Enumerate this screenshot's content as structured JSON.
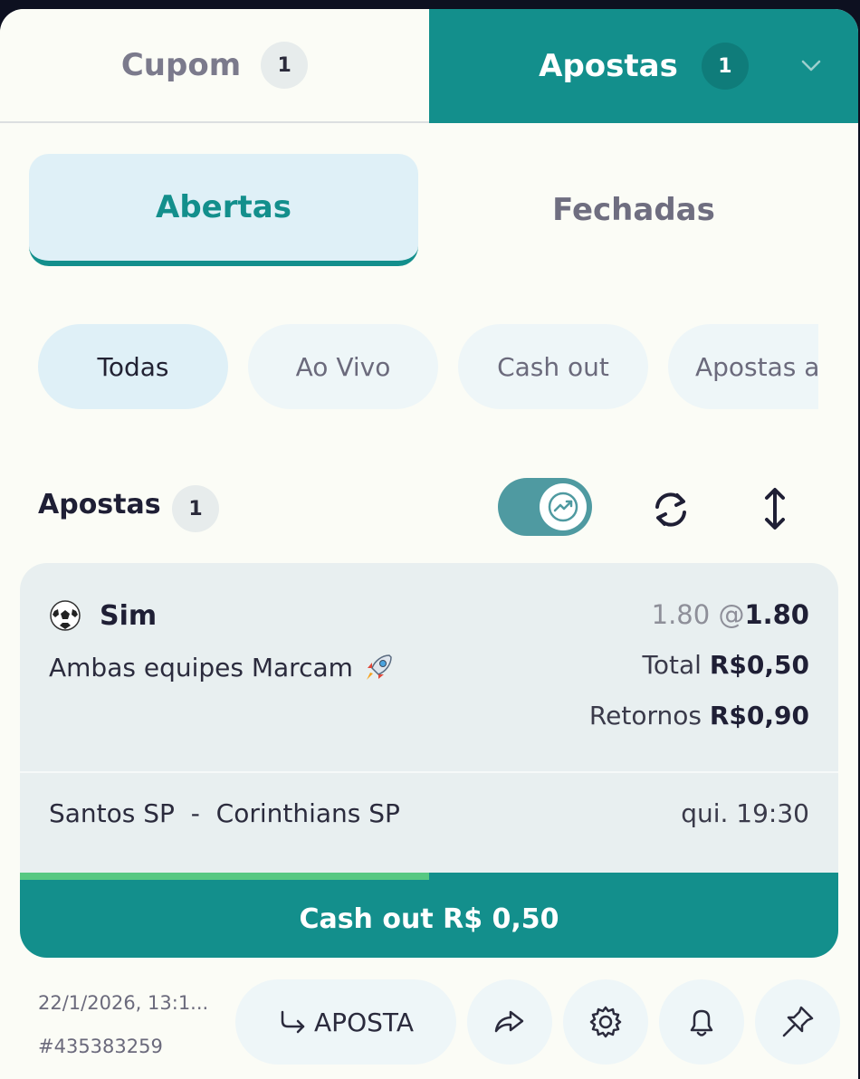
{
  "tabs": {
    "cupom": {
      "label": "Cupom",
      "count": "1"
    },
    "apostas": {
      "label": "Apostas",
      "count": "1"
    }
  },
  "segment": {
    "open": "Abertas",
    "closed": "Fechadas"
  },
  "filters": [
    "Todas",
    "Ao Vivo",
    "Cash out",
    "Apostas a"
  ],
  "section": {
    "title": "Apostas",
    "count": "1"
  },
  "bet": {
    "selection": "Sim",
    "market": "Ambas equipes Marcam",
    "odds_original": "1.80",
    "odds_separator": "@",
    "odds_current": "1.80",
    "total_label": "Total",
    "total_value": "R$0,50",
    "returns_label": "Retornos",
    "returns_value": "R$0,90",
    "match": "Santos SP  -  Corinthians SP",
    "time": "qui. 19:30",
    "progress": 0.5,
    "cashout_label": "Cash out R$ 0,50"
  },
  "footer": {
    "date": "22/1/2026, 13:1...",
    "id": "#435383259",
    "rebet_label": "APOSTA"
  },
  "colors": {
    "accent": "#138f8c",
    "progress": "#57c882",
    "card": "#e8eff0",
    "background": "#fbfcf6"
  },
  "icons": [
    "chevron-down-icon",
    "trend-icon",
    "refresh-icon",
    "sort-icon",
    "soccer-ball-icon",
    "rocket-icon",
    "rebet-icon",
    "share-icon",
    "gear-icon",
    "bell-icon",
    "pin-icon"
  ]
}
